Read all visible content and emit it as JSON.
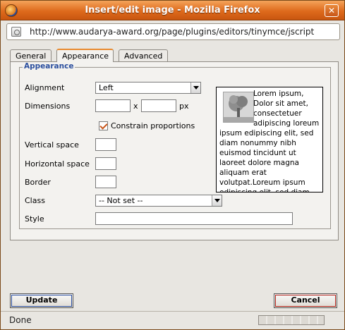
{
  "window": {
    "title": "Insert/edit image - Mozilla Firefox",
    "close_label": "✕"
  },
  "urlbar": {
    "url": "http://www.audarya-award.org/page/plugins/editors/tinymce/jscript"
  },
  "tabs": [
    {
      "label": "General",
      "active": false
    },
    {
      "label": "Appearance",
      "active": true
    },
    {
      "label": "Advanced",
      "active": false
    }
  ],
  "appearance": {
    "legend": "Appearance",
    "alignment_label": "Alignment",
    "alignment_value": "Left",
    "dimensions_label": "Dimensions",
    "dimensions_width": "",
    "dimensions_x": "x",
    "dimensions_height": "",
    "dimensions_unit": "px",
    "constrain_label": "Constrain proportions",
    "constrain_checked": true,
    "vspace_label": "Vertical space",
    "vspace_value": "",
    "hspace_label": "Horizontal space",
    "hspace_value": "",
    "border_label": "Border",
    "border_value": "",
    "class_label": "Class",
    "class_value": "-- Not set --",
    "style_label": "Style",
    "style_value": "",
    "preview_text": "Lorem ipsum, Dolor sit amet, consectetuer adipiscing loreum ipsum edipiscing elit, sed diam nonummy nibh euismod tincidunt ut laoreet dolore magna aliquam erat volutpat.Loreum ipsum edipiscing elit, sed diam"
  },
  "buttons": {
    "update": "Update",
    "cancel": "Cancel"
  },
  "status": {
    "text": "Done"
  }
}
